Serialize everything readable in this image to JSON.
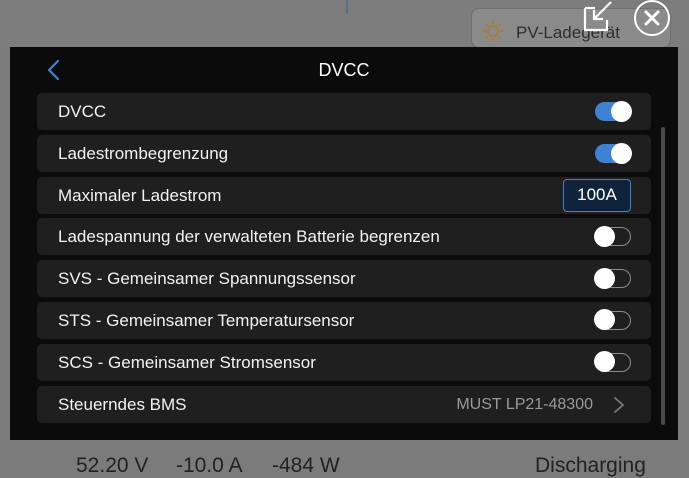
{
  "background": {
    "pill_label": "PV-Ladegerät",
    "status_bar": {
      "voltage": "52.20 V",
      "current": "-10.0 A",
      "power": "-484 W",
      "state": "Discharging"
    }
  },
  "modal": {
    "title": "DVCC",
    "rows": [
      {
        "label": "DVCC",
        "type": "toggle",
        "state": "on"
      },
      {
        "label": "Ladestrombegrenzung",
        "type": "toggle",
        "state": "on"
      },
      {
        "label": "Maximaler Ladestrom",
        "type": "value",
        "value": "100A"
      },
      {
        "label": "Ladespannung der verwalteten Batterie begrenzen",
        "type": "toggle",
        "state": "off"
      },
      {
        "label": "SVS - Gemeinsamer Spannungssensor",
        "type": "toggle",
        "state": "off"
      },
      {
        "label": "STS - Gemeinsamer Temperatursensor",
        "type": "toggle",
        "state": "off"
      },
      {
        "label": "SCS - Gemeinsamer Stromsensor",
        "type": "toggle",
        "state": "off"
      },
      {
        "label": "Steuerndes BMS",
        "type": "select",
        "value": "MUST LP21-48300"
      }
    ]
  },
  "colors": {
    "accent": "#3f82d4",
    "modal_bg": "#0b0b0b",
    "row_bg": "#1f1f1f"
  },
  "icons": [
    "back-icon",
    "expand-icon",
    "close-icon",
    "sun-icon",
    "chevron-right-icon"
  ]
}
